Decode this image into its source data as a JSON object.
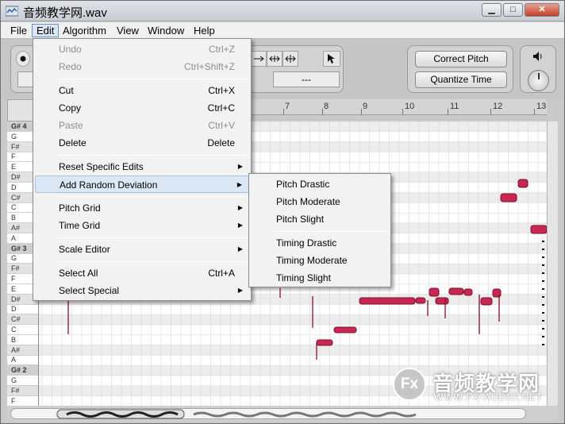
{
  "window": {
    "title": "音频教学网.wav",
    "controls": {
      "minimize": "▁",
      "maximize": "□",
      "close": "✕"
    }
  },
  "menubar": {
    "items": [
      "File",
      "Edit",
      "Algorithm",
      "View",
      "Window",
      "Help"
    ],
    "open_menu": "Edit"
  },
  "toolbar": {
    "field_value": "---",
    "correct_pitch_label": "Correct Pitch",
    "quantize_time_label": "Quantize Time",
    "volume_icon": "speaker-icon"
  },
  "ruler": {
    "labels": [
      "7",
      "8",
      "9",
      "10",
      "11",
      "12",
      "13"
    ]
  },
  "piano_keys": [
    "G# 4",
    "G",
    "F#",
    "F",
    "E",
    "D#",
    "D",
    "C#",
    "C",
    "B",
    "A#",
    "A",
    "G# 3",
    "G",
    "F#",
    "F",
    "E",
    "D#",
    "D",
    "C#",
    "C",
    "B",
    "A#",
    "A",
    "G# 2",
    "G",
    "F#",
    "F"
  ],
  "edit_menu": {
    "items": [
      {
        "label": "Undo",
        "shortcut": "Ctrl+Z",
        "disabled": true
      },
      {
        "label": "Redo",
        "shortcut": "Ctrl+Shift+Z",
        "disabled": true
      },
      {
        "label": "Cut",
        "shortcut": "Ctrl+X"
      },
      {
        "label": "Copy",
        "shortcut": "Ctrl+C"
      },
      {
        "label": "Paste",
        "shortcut": "Ctrl+V",
        "disabled": true
      },
      {
        "label": "Delete",
        "shortcut": "Delete"
      },
      {
        "label": "Reset Specific Edits",
        "submenu": true
      },
      {
        "label": "Add Random Deviation",
        "submenu": true,
        "highlighted": true
      },
      {
        "label": "Pitch Grid",
        "submenu": true
      },
      {
        "label": "Time Grid",
        "submenu": true
      },
      {
        "label": "Scale Editor",
        "submenu": true
      },
      {
        "label": "Select All",
        "shortcut": "Ctrl+A"
      },
      {
        "label": "Select Special",
        "submenu": true
      }
    ]
  },
  "random_deviation_submenu": {
    "items": [
      "Pitch Drastic",
      "Pitch Moderate",
      "Pitch Slight",
      "Timing Drastic",
      "Timing Moderate",
      "Timing Slight"
    ]
  },
  "watermark": {
    "badge": "Fx",
    "chinese": "音频教学网",
    "url": "WWW.FX-AUDIO.NET"
  },
  "colors": {
    "note_fill": "#c8284f",
    "note_outline": "#7a1030",
    "menu_highlight": "#dce7f5"
  }
}
